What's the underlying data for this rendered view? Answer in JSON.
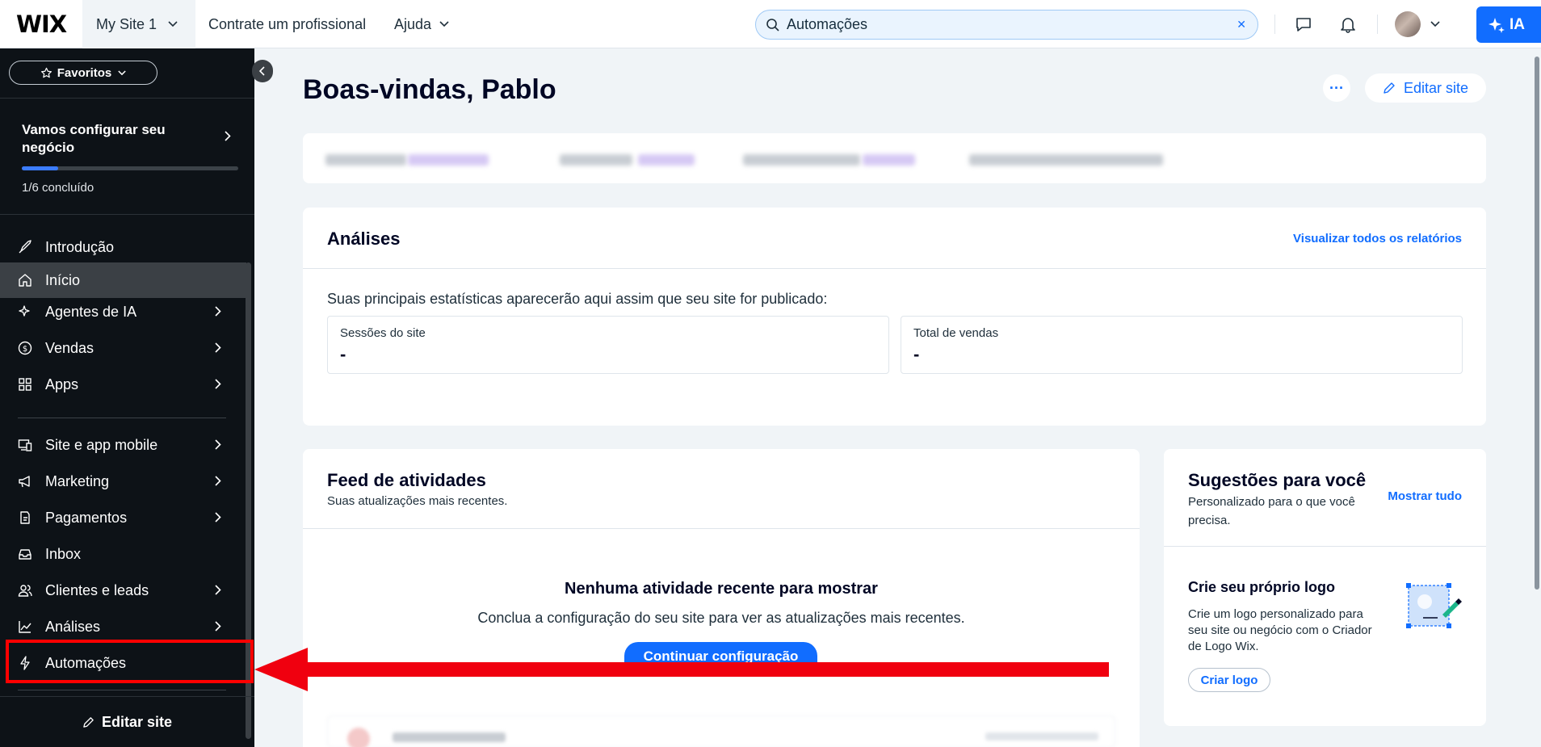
{
  "topbar": {
    "logo": "WIX",
    "site_name": "My Site 1",
    "nav": [
      "Contrate um profissional",
      "Ajuda"
    ],
    "search_value": "Automações",
    "ai_label": "IA"
  },
  "sidebar": {
    "favorites_label": "Favoritos",
    "setup": {
      "title": "Vamos configurar seu negócio",
      "progress_text": "1/6 concluído",
      "progress_fraction": 0.167
    },
    "items": [
      {
        "label": "Introdução",
        "icon": "rocket-icon",
        "arrow": false
      },
      {
        "label": "Início",
        "icon": "home-icon",
        "arrow": false,
        "active": true
      },
      {
        "label": "Agentes de IA",
        "icon": "sparkle-icon",
        "arrow": true
      },
      {
        "label": "Vendas",
        "icon": "dollar-icon",
        "arrow": true
      },
      {
        "label": "Apps",
        "icon": "apps-icon",
        "arrow": true
      },
      {
        "label": "Site e app mobile",
        "icon": "devices-icon",
        "arrow": true
      },
      {
        "label": "Marketing",
        "icon": "megaphone-icon",
        "arrow": true
      },
      {
        "label": "Pagamentos",
        "icon": "card-icon",
        "arrow": true
      },
      {
        "label": "Inbox",
        "icon": "inbox-icon",
        "arrow": false
      },
      {
        "label": "Clientes e leads",
        "icon": "people-icon",
        "arrow": true
      },
      {
        "label": "Análises",
        "icon": "chart-icon",
        "arrow": true
      },
      {
        "label": "Automações",
        "icon": "bolt-icon",
        "arrow": false
      }
    ],
    "edit_site_label": "Editar site"
  },
  "main": {
    "welcome": "Boas-vindas, Pablo",
    "edit_site_label": "Editar site",
    "analytics": {
      "title": "Análises",
      "view_all": "Visualizar todos os relatórios",
      "intro": "Suas principais estatísticas aparecerão aqui assim que seu site for publicado:",
      "stats": [
        {
          "label": "Sessões do site",
          "value": "-"
        },
        {
          "label": "Total de vendas",
          "value": "-"
        }
      ]
    },
    "feed": {
      "title": "Feed de atividades",
      "subtitle": "Suas atualizações mais recentes.",
      "empty_title": "Nenhuma atividade recente para mostrar",
      "empty_text": "Conclua a configuração do seu site para ver as atualizações mais recentes.",
      "cta": "Continuar configuração"
    },
    "suggestions": {
      "title": "Sugestões para você",
      "subtitle": "Personalizado para o que você precisa.",
      "show_all": "Mostrar tudo",
      "item_title": "Crie seu próprio logo",
      "item_text": "Crie um logo personalizado para seu site ou negócio com o Criador de Logo Wix.",
      "item_button": "Criar logo"
    }
  },
  "colors": {
    "accent": "#116dff",
    "sidebar_bg": "#0d1217",
    "highlight": "#ff0000"
  }
}
